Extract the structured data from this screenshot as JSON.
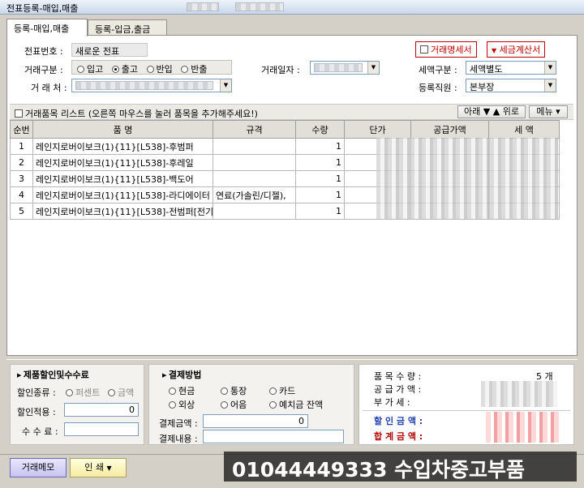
{
  "window": {
    "title": "전표등록-매입,매출",
    "title_extra_1": "",
    "title_extra_2": ""
  },
  "tabs": [
    {
      "label": "등록-매입,매출"
    },
    {
      "label": "등록-입금,출금"
    }
  ],
  "header": {
    "voucher_no_label": "전표번호 :",
    "voucher_no_value": "새로운 전표",
    "trade_type_label": "거래구분 :",
    "trade_type_options": [
      "입고",
      "출고",
      "반입",
      "반출"
    ],
    "trade_type_selected": "출고",
    "trade_date_label": "거래일자 :",
    "client_label": "거 래 처 :",
    "statement_checkbox": "거래명세서",
    "tax_invoice_checkbox": "세금계산서",
    "tax_type_label": "세액구분 :",
    "tax_type_value": "세액별도",
    "staff_label": "등록직원 :",
    "staff_value": "본부장"
  },
  "items_bar": {
    "title": "거래품목 리스트 (오른쪽 마우스를 눌러 품목을 추가해주세요!)",
    "move_button": "아래 ▼ ▲ 위로",
    "menu_button": "메뉴 ▾"
  },
  "table": {
    "columns": [
      "순번",
      "품        명",
      "규격",
      "수량",
      "단가",
      "공급가액",
      "세    액"
    ],
    "rows": [
      {
        "no": "1",
        "name": "레인지로버이보크(1){11}[L538]-후범퍼",
        "spec": "",
        "qty": "1"
      },
      {
        "no": "2",
        "name": "레인지로버이보크(1){11}[L538]-후레일",
        "spec": "",
        "qty": "1"
      },
      {
        "no": "3",
        "name": "레인지로버이보크(1){11}[L538]-백도어",
        "spec": "",
        "qty": "1"
      },
      {
        "no": "4",
        "name": "레인지로버이보크(1){11}[L538]-라디에이터",
        "spec": "연료(가솔린/디젤),",
        "qty": "1"
      },
      {
        "no": "5",
        "name": "레인지로버이보크(1){11}[L538]-전범퍼[전기",
        "spec": "",
        "qty": "1"
      }
    ]
  },
  "discount": {
    "title": "제품할인및수수료",
    "kind_label": "할인종류 :",
    "kind_options": [
      "퍼센트",
      "금액"
    ],
    "apply_label": "할인적용 :",
    "apply_value": "0",
    "fee_label": "수 수 료 :"
  },
  "payment": {
    "title": "결제방법",
    "options": [
      "현금",
      "통장",
      "카드",
      "외상",
      "어음",
      "예치금 잔액"
    ],
    "amount_label": "결제금액 :",
    "amount_value": "0",
    "memo_label": "결제내용 :"
  },
  "summary": {
    "item_count_label": "품 목 수 량 :",
    "item_count_value": "5 개",
    "supply_label": "공 급 가 액 :",
    "vat_label": "부   가   세 :",
    "discount_label": "할 인 금 액 :",
    "total_label": "합 계 금 액 :"
  },
  "footer": {
    "memo_button": "거래메모",
    "print_button": "인  쇄"
  },
  "watermark": {
    "text": "01044449333 수입차중고부품"
  }
}
